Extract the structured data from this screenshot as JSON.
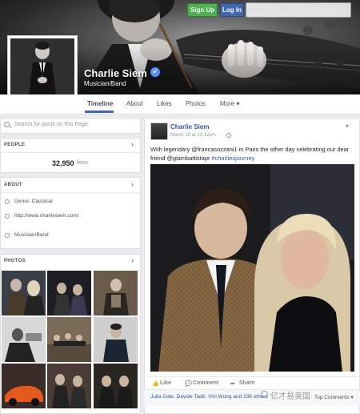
{
  "header": {
    "signup_label": "Sign Up",
    "login_label": "Log In"
  },
  "page": {
    "name": "Charlie Siem",
    "category": "Musician/Band",
    "verified_icon": "check-icon"
  },
  "tabs": [
    {
      "label": "Timeline",
      "active": true
    },
    {
      "label": "About"
    },
    {
      "label": "Likes"
    },
    {
      "label": "Photos"
    },
    {
      "label": "More ▾"
    }
  ],
  "sidebar": {
    "search_placeholder": "Search for posts on this Page",
    "people": {
      "title": "PEOPLE",
      "likes_count": "32,950",
      "likes_suffix": "likes"
    },
    "about": {
      "title": "ABOUT",
      "genre": "Genre: Classical",
      "website": "http://www.charliesiem.com/",
      "category": "Musician/Band"
    },
    "photos": {
      "title": "PHOTOS"
    }
  },
  "post": {
    "author": "Charlie Siem",
    "time": "March 10 at 12:12pm · ",
    "text_parts": {
      "p1": "With legendary @francasozzani1 in Paris the other day celebrating our dear friend @giambattistapr ",
      "p2": "#charliesjourney"
    },
    "actions": {
      "like": "Like",
      "comment": "Comment",
      "share": "Share"
    },
    "reactions": "Julia Gale, Davide Tadè, Vini Wong and 236 others",
    "top_comments": "Top Comments ▾"
  },
  "watermark": "亿才易美国",
  "colors": {
    "brand_blue": "#4267b2",
    "link_blue": "#365899",
    "signup_green": "#4caf50"
  }
}
